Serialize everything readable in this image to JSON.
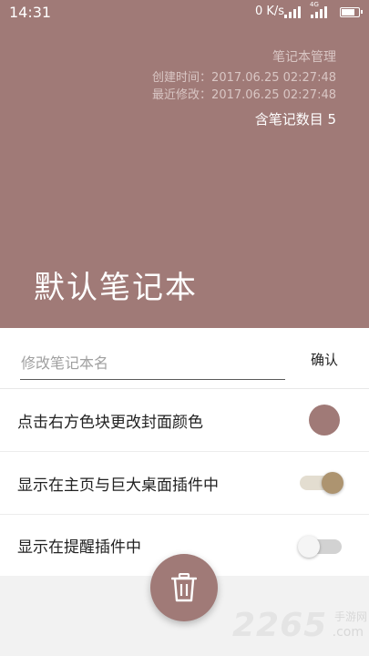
{
  "status_bar": {
    "time": "14:31",
    "net_speed": "0 K/s",
    "network_type": "4G",
    "battery_percent": 80
  },
  "cover": {
    "color": "#a07a77",
    "header_title": "笔记本管理",
    "created": "创建时间：2017.06.25  02:27:48",
    "modified": "最近修改：2017.06.25  02:27:48",
    "note_count": "含笔记数目  5",
    "notebook_name": "默认笔记本"
  },
  "rename": {
    "placeholder": "修改笔记本名",
    "value": "",
    "confirm_label": "确认"
  },
  "settings": {
    "cover_color_label": "点击右方色块更改封面颜色",
    "cover_color": "#a07a77",
    "home_widget_label": "显示在主页与巨大桌面插件中",
    "home_widget_on": true,
    "reminder_widget_label": "显示在提醒插件中",
    "reminder_widget_on": false
  },
  "fab": {
    "icon": "trash-icon"
  },
  "watermark": {
    "number": "2265",
    "cn": "手游网",
    "domain": ".com"
  }
}
